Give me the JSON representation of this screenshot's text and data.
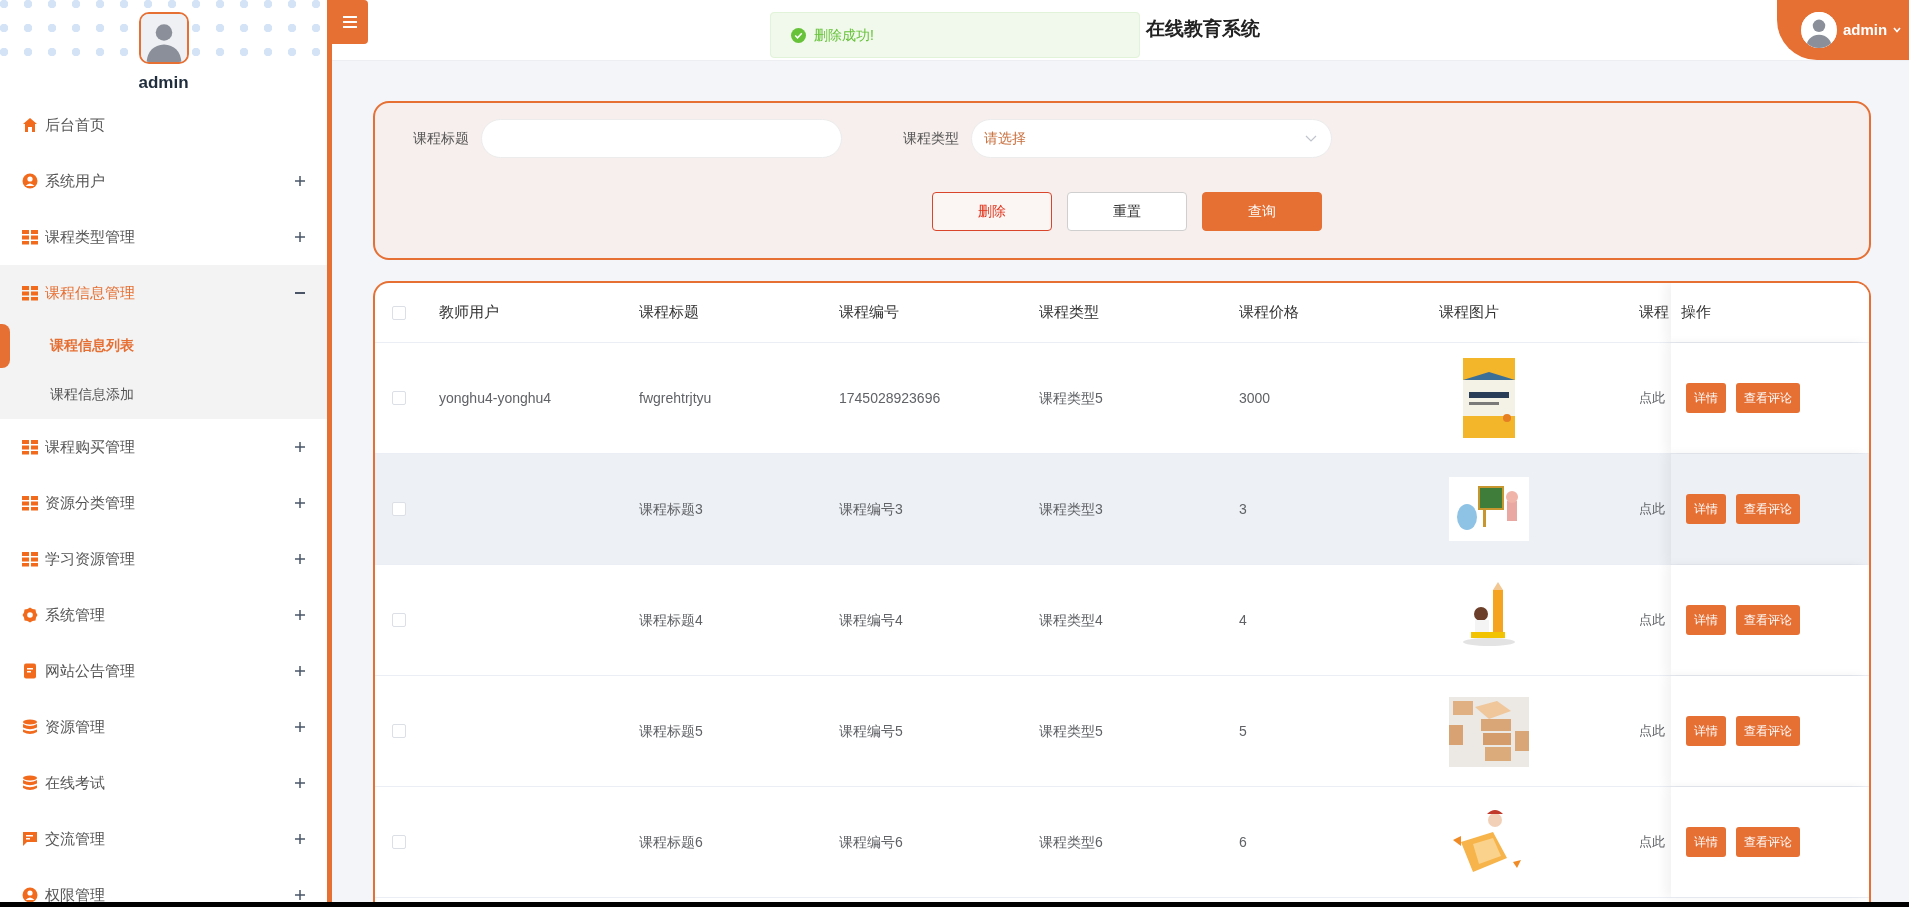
{
  "sidebar": {
    "username": "admin",
    "menu": [
      {
        "label": "后台首页"
      },
      {
        "label": "系统用户",
        "expanded": false
      },
      {
        "label": "课程类型管理",
        "expanded": false
      },
      {
        "label": "课程信息管理",
        "expanded": true,
        "children": [
          {
            "label": "课程信息列表",
            "selected": true
          },
          {
            "label": "课程信息添加",
            "selected": false
          }
        ]
      },
      {
        "label": "课程购买管理",
        "expanded": false
      },
      {
        "label": "资源分类管理",
        "expanded": false
      },
      {
        "label": "学习资源管理",
        "expanded": false
      },
      {
        "label": "系统管理",
        "expanded": false
      },
      {
        "label": "网站公告管理",
        "expanded": false
      },
      {
        "label": "资源管理",
        "expanded": false
      },
      {
        "label": "在线考试",
        "expanded": false
      },
      {
        "label": "交流管理",
        "expanded": false
      },
      {
        "label": "权限管理",
        "expanded": false
      }
    ]
  },
  "header": {
    "title": "在线教育系统",
    "user": "admin"
  },
  "toast": {
    "message": "删除成功!"
  },
  "search": {
    "fields": [
      {
        "label": "课程标题",
        "kind": "text"
      },
      {
        "label": "课程类型",
        "kind": "select",
        "placeholder": "请选择"
      }
    ],
    "buttons": [
      {
        "label": "删除",
        "kind": "danger"
      },
      {
        "label": "重置",
        "kind": "plain"
      },
      {
        "label": "查询",
        "kind": "primary"
      }
    ]
  },
  "table": {
    "header_checked": false,
    "columns": [
      "教师用户",
      "课程标题",
      "课程编号",
      "课程类型",
      "课程价格",
      "课程图片",
      "课程",
      "操作"
    ],
    "rows": [
      {
        "checked": false,
        "hovered": false,
        "teacher": "yonghu4-yonghu4",
        "title": "fwgrehtrjtyu",
        "code": "1745028923696",
        "type": "课程类型5",
        "price": "3000",
        "picture": {
          "kind": "picture"
        },
        "column_8": "点此",
        "actions": [
          "详情",
          "查看评论"
        ]
      },
      {
        "checked": false,
        "hovered": true,
        "title": "课程标题3",
        "code": "课程编号3",
        "type": "课程类型3",
        "price": "3",
        "picture": {
          "kind": "picture"
        },
        "column_8": "点此",
        "actions": [
          "详情",
          "查看评论"
        ]
      },
      {
        "checked": false,
        "hovered": false,
        "title": "课程标题4",
        "code": "课程编号4",
        "type": "课程类型4",
        "price": "4",
        "picture": {
          "kind": "picture"
        },
        "column_8": "点此",
        "actions": [
          "详情",
          "查看评论"
        ]
      },
      {
        "checked": false,
        "hovered": false,
        "title": "课程标题5",
        "code": "课程编号5",
        "type": "课程类型5",
        "price": "5",
        "picture": {
          "kind": "picture"
        },
        "column_8": "点此",
        "actions": [
          "详情",
          "查看评论"
        ]
      },
      {
        "checked": false,
        "hovered": false,
        "title": "课程标题6",
        "code": "课程编号6",
        "type": "课程类型6",
        "price": "6",
        "picture": {
          "kind": "picture"
        },
        "column_8": "点此",
        "actions": [
          "详情",
          "查看评论"
        ]
      }
    ]
  }
}
